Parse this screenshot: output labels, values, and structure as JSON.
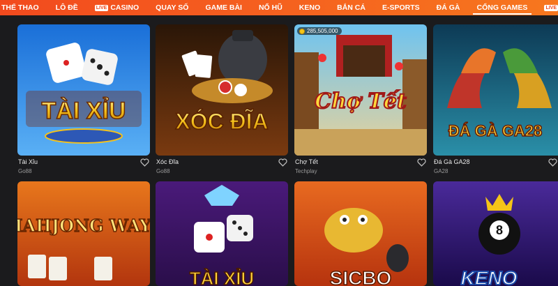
{
  "nav": {
    "items": [
      {
        "label": "THỂ THAO",
        "live": false
      },
      {
        "label": "LÔ ĐỀ",
        "live": false
      },
      {
        "label": "CASINO",
        "live": true
      },
      {
        "label": "QUAY SỐ",
        "live": false
      },
      {
        "label": "GAME BÀI",
        "live": false
      },
      {
        "label": "NỔ HŨ",
        "live": false
      },
      {
        "label": "KENO",
        "live": false
      },
      {
        "label": "BẮN CÁ",
        "live": false
      },
      {
        "label": "E-SPORTS",
        "live": false
      },
      {
        "label": "ĐÁ GÀ",
        "live": false
      },
      {
        "label": "CỔNG GAMES",
        "live": false,
        "active": true
      },
      {
        "label": "",
        "live": true
      }
    ],
    "live_badge": "LIVE"
  },
  "games": [
    {
      "name": "Tài Xỉu",
      "provider": "Go88",
      "art_text": "TÀI XỈU"
    },
    {
      "name": "Xóc Đĩa",
      "provider": "Go88",
      "art_text": "XÓC ĐĨA"
    },
    {
      "name": "Chợ Tết",
      "provider": "Techplay",
      "art_text": "Chợ Tết",
      "jackpot": "285,505,000"
    },
    {
      "name": "Đá Gà GA28",
      "provider": "GA28",
      "art_text": "ĐÁ GÀ GA28"
    },
    {
      "art_text": "MAHJONG WAYS"
    },
    {
      "art_text": "TÀI XỈU"
    },
    {
      "art_text": "SICBO"
    },
    {
      "art_text": "KENO"
    }
  ],
  "colors": {
    "nav_start": "#f24a1e",
    "nav_end": "#f7771e",
    "page_bg": "#1b1b1d",
    "card_text": "#e8e8e8",
    "provider_text": "#9a9a9a"
  },
  "icons": {
    "favorite": "heart-outline-icon",
    "jackpot": "coin-icon"
  }
}
